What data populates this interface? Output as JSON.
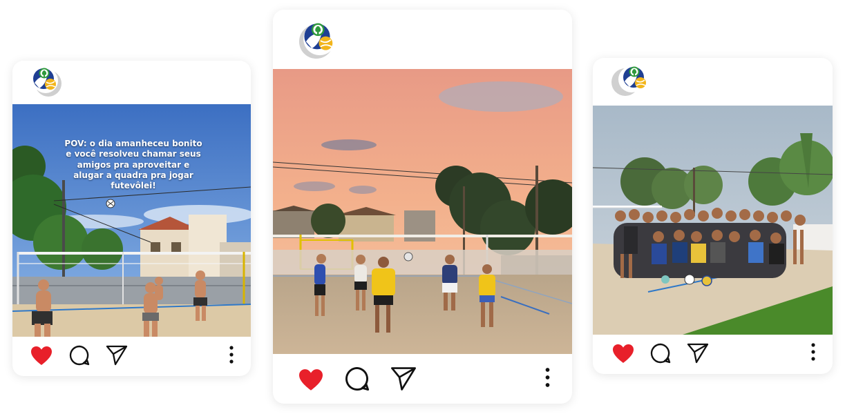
{
  "posts": [
    {
      "caption": "POV: o dia amanheceu bonito e você resolveu chamar seus amigos pra aproveitar e alugar a quadra pra jogar futevôlei!",
      "icons": [
        "brand-logo",
        "heart-icon",
        "comment-icon",
        "share-icon",
        "more-icon"
      ]
    },
    {
      "icons": [
        "brand-logo",
        "heart-icon",
        "comment-icon",
        "share-icon",
        "more-icon"
      ]
    },
    {
      "icons": [
        "brand-logo",
        "heart-icon",
        "comment-icon",
        "share-icon",
        "more-icon"
      ]
    }
  ],
  "colors": {
    "heart": "#e8202a",
    "icon_stroke": "#111111",
    "logo_blue": "#1f3f93",
    "logo_green": "#2f9a3c",
    "logo_yellow": "#f2b51b",
    "logo_gray": "#d0d0d0",
    "sand": "#d9c4a0",
    "grass": "#4f8a2f"
  }
}
